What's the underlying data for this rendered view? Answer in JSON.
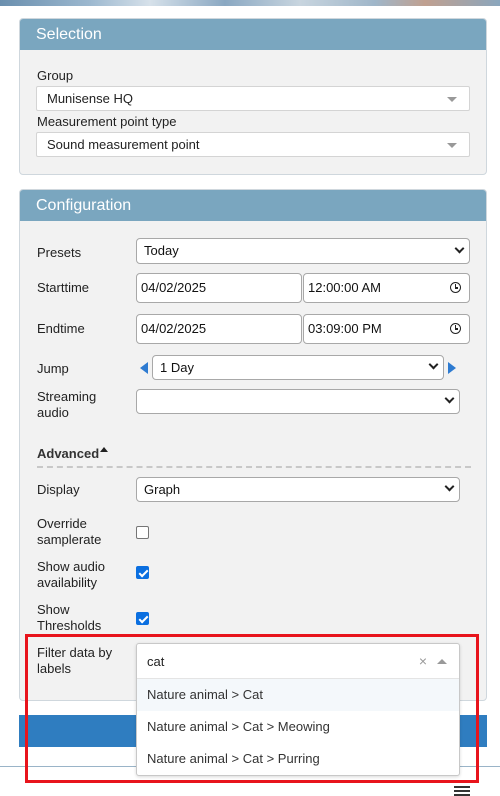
{
  "selection": {
    "title": "Selection",
    "group_label": "Group",
    "group_value": "Munisense HQ",
    "mpt_label": "Measurement point type",
    "mpt_value": "Sound measurement point"
  },
  "configuration": {
    "title": "Configuration",
    "presets_label": "Presets",
    "presets_value": "Today",
    "starttime_label": "Starttime",
    "start_date": "04/02/2025",
    "start_time": "12:00:00 AM",
    "endtime_label": "Endtime",
    "end_date": "04/02/2025",
    "end_time": "03:09:00 PM",
    "jump_label": "Jump",
    "jump_value": "1 Day",
    "streaming_label_1": "Streaming",
    "streaming_label_2": "audio",
    "streaming_value": "",
    "advanced_label": "Advanced",
    "display_label": "Display",
    "display_value": "Graph",
    "override_label_1": "Override",
    "override_label_2": "samplerate",
    "override_checked": false,
    "show_audio_label_1": "Show audio",
    "show_audio_label_2": "availability",
    "show_audio_checked": true,
    "show_thresholds_label_1": "Show",
    "show_thresholds_label_2": "Thresholds",
    "show_thresholds_checked": true,
    "filter_label_1": "Filter data by",
    "filter_label_2": "labels"
  },
  "filter_dropdown": {
    "search_value": "cat",
    "clear_glyph": "×",
    "options": [
      "Nature animal > Cat",
      "Nature animal > Cat > Meowing",
      "Nature animal > Cat > Purring"
    ]
  },
  "colors": {
    "panel_header": "#7aa6bf",
    "accent_blue": "#2f7dc0",
    "highlight_frame": "#e8141c",
    "checkbox_on": "#0b6fe0"
  }
}
